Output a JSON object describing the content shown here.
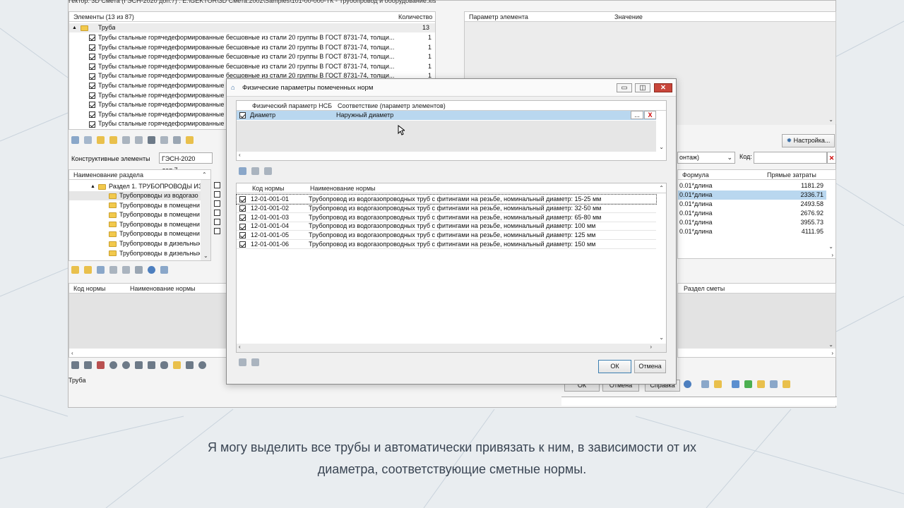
{
  "window": {
    "title": "Гектор: 3D Смета (ГЭСН-2020 доп.7) : E:\\GEKTOR\\3D Смета.2002\\Samples\\101-00-000-ТК - Трубопровод и оборудование.xls"
  },
  "elements": {
    "header_name": "Элементы (13 из 87)",
    "header_qty": "Количество",
    "group": {
      "label": "Труба",
      "qty": "13"
    },
    "items": [
      {
        "label": "Трубы стальные горячедеформированные бесшовные из стали 20 группы В ГОСТ 8731-74, толщи...",
        "qty": "1"
      },
      {
        "label": "Трубы стальные горячедеформированные бесшовные из стали 20 группы В ГОСТ 8731-74, толщи...",
        "qty": "1"
      },
      {
        "label": "Трубы стальные горячедеформированные бесшовные из стали 20 группы В ГОСТ 8731-74, толщи...",
        "qty": "1"
      },
      {
        "label": "Трубы стальные горячедеформированные бесшовные из стали 20 группы В ГОСТ 8731-74, толщи...",
        "qty": "1"
      },
      {
        "label": "Трубы стальные горячедеформированные бесшовные из стали 20 группы В ГОСТ 8731-74, толщи...",
        "qty": "1"
      },
      {
        "label": "Трубы стальные горячедеформированные б",
        "qty": ""
      },
      {
        "label": "Трубы стальные горячедеформированные б",
        "qty": ""
      },
      {
        "label": "Трубы стальные горячедеформированные б",
        "qty": ""
      },
      {
        "label": "Трубы стальные горячедеформированные б",
        "qty": ""
      },
      {
        "label": "Трубы стальные горячедеформированные б",
        "qty": ""
      }
    ]
  },
  "params": {
    "header_param": "Параметр элемента",
    "header_value": "Значение"
  },
  "settings_button": "Настройка...",
  "tabs": {
    "constructive": "Конструктивные элементы",
    "base": "ГЭСН-2020 доп.7"
  },
  "section": {
    "header": "Наименование раздела",
    "root": "Раздел 1. ТРУБОПРОВОДЫ ИЗ",
    "items": [
      "Трубопроводы из водогазо",
      "Трубопроводы в помещени",
      "Трубопроводы в помещени",
      "Трубопроводы в помещени",
      "Трубопроводы в помещени",
      "Трубопроводы в дизельных",
      "Трубопроводы в дизельных"
    ]
  },
  "right_filter": {
    "combo": "онтаж)",
    "code_label": "Код:"
  },
  "right_table": {
    "header_formula": "Формула",
    "header_cost": "Прямые затраты",
    "rows": [
      {
        "formula": "0.01*длина",
        "cost": "1181.29"
      },
      {
        "formula": "0.01*длина",
        "cost": "2336.71"
      },
      {
        "formula": "0.01*длина",
        "cost": "2493.58"
      },
      {
        "formula": "0.01*длина",
        "cost": "2676.92"
      },
      {
        "formula": "0.01*длина",
        "cost": "3955.73"
      },
      {
        "formula": "0.01*длина",
        "cost": "4111.95"
      }
    ]
  },
  "bottom_table": {
    "header_code": "Код нормы",
    "header_name": "Наименование нормы",
    "header_section": "Раздел сметы"
  },
  "status": "Труба",
  "bottom_buttons": {
    "ok": "ОК",
    "cancel": "Отмена",
    "help": "Справка"
  },
  "dialog": {
    "title": "Физические параметры помеченных норм",
    "top_headers": {
      "param": "Физический параметр НСБ",
      "match": "Соответствие (параметр элементов)"
    },
    "top_row": {
      "param": "Диаметр",
      "match": "Наружный диаметр",
      "dots": "...",
      "x": "X"
    },
    "norm_headers": {
      "code": "Код нормы",
      "name": "Наименование нормы"
    },
    "norms": [
      {
        "code": "12-01-001-01",
        "name": "Трубопровод из водогазопроводных труб с фитингами на резьбе, номинальный диаметр: 15-25 мм"
      },
      {
        "code": "12-01-001-02",
        "name": "Трубопровод из водогазопроводных труб с фитингами на резьбе, номинальный диаметр: 32-50 мм"
      },
      {
        "code": "12-01-001-03",
        "name": "Трубопровод из водогазопроводных труб с фитингами на резьбе, номинальный диаметр: 65-80 мм"
      },
      {
        "code": "12-01-001-04",
        "name": "Трубопровод из водогазопроводных труб с фитингами на резьбе, номинальный диаметр: 100 мм"
      },
      {
        "code": "12-01-001-05",
        "name": "Трубопровод из водогазопроводных труб с фитингами на резьбе, номинальный диаметр: 125 мм"
      },
      {
        "code": "12-01-001-06",
        "name": "Трубопровод из водогазопроводных труб с фитингами на резьбе, номинальный диаметр: 150 мм"
      }
    ],
    "ok": "ОК",
    "cancel": "Отмена"
  },
  "caption": {
    "line1": "Я могу выделить все трубы и автоматически привязать к ним, в зависимости от их",
    "line2": "диаметра, соответствующие сметные нормы."
  }
}
